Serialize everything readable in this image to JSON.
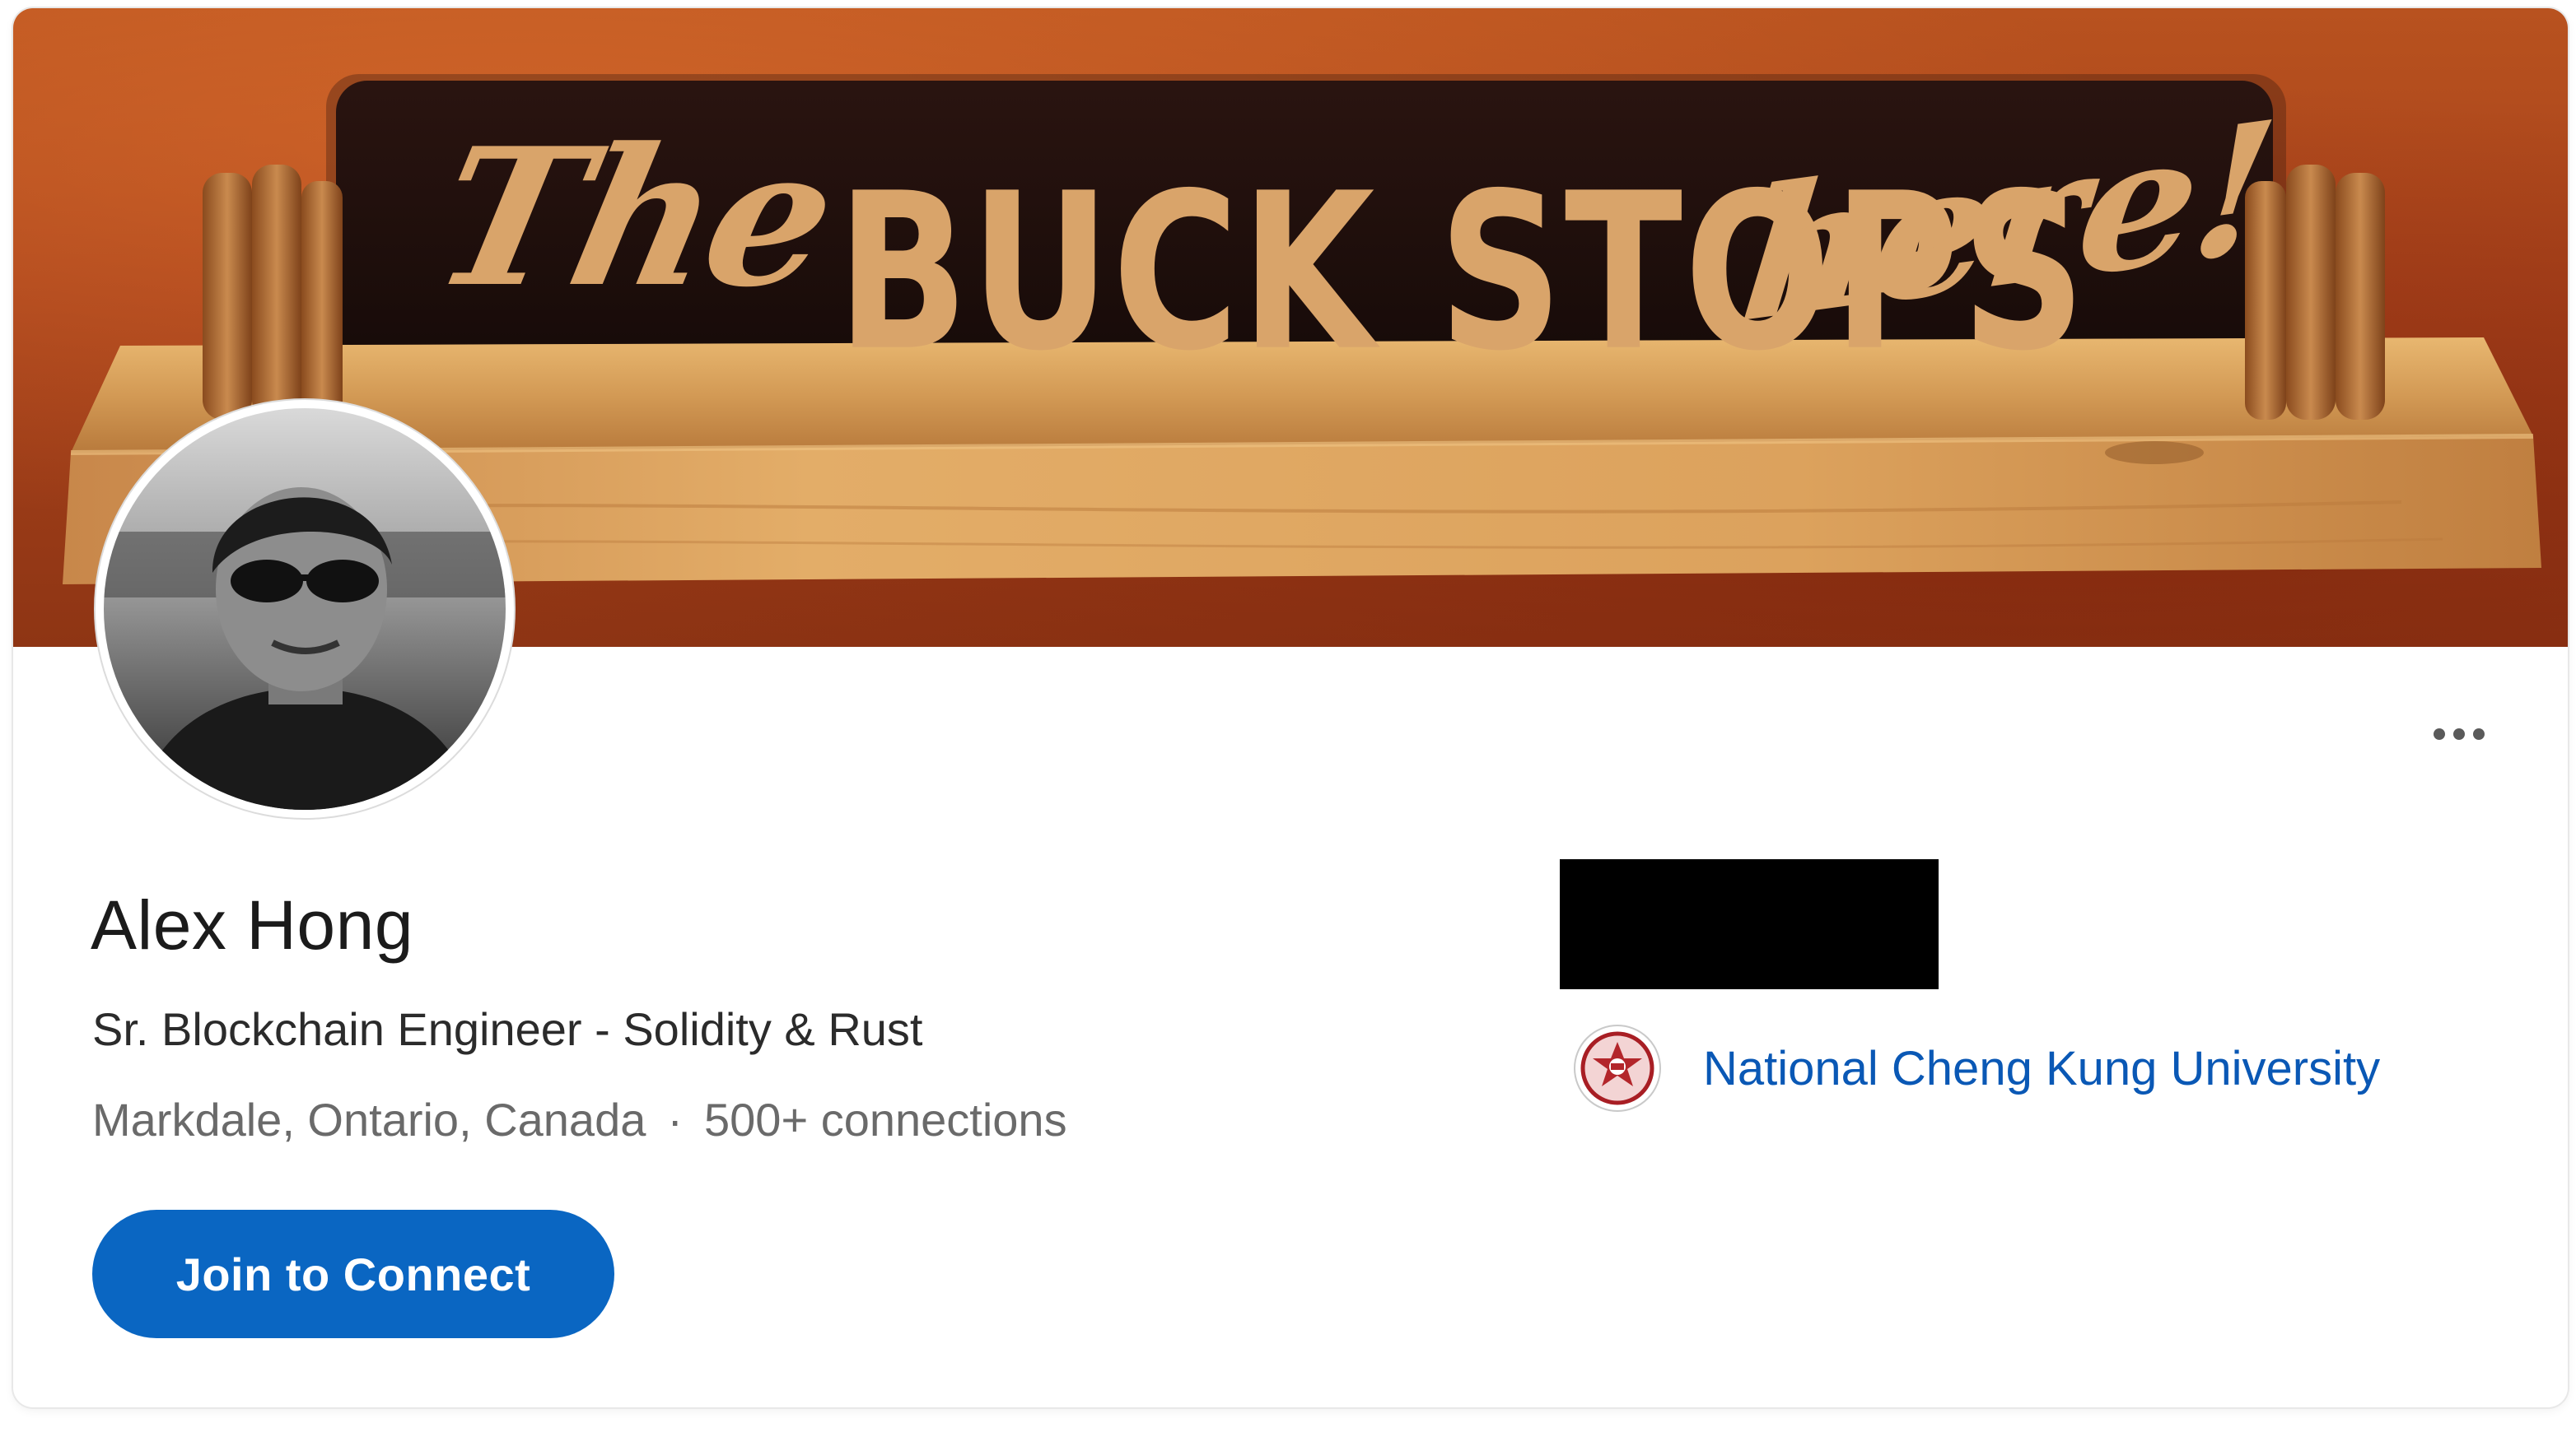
{
  "cover": {
    "sign_words": [
      "The",
      "BUCK STOPS",
      "here!"
    ]
  },
  "profile": {
    "name": "Alex Hong",
    "headline": "Sr. Blockchain Engineer - Solidity & Rust",
    "location": "Markdale, Ontario, Canada",
    "separator": "·",
    "connections": "500+ connections"
  },
  "actions": {
    "join_label": "Join to Connect",
    "more_icon": "more-horizontal-icon"
  },
  "education": {
    "school": "National Cheng Kung University",
    "logo_icon": "university-seal-icon"
  },
  "colors": {
    "primary_button": "#0a66c2",
    "link": "#0a58b5",
    "cover_base": "#a8421b",
    "sign_lettering": "#d9a46a"
  }
}
